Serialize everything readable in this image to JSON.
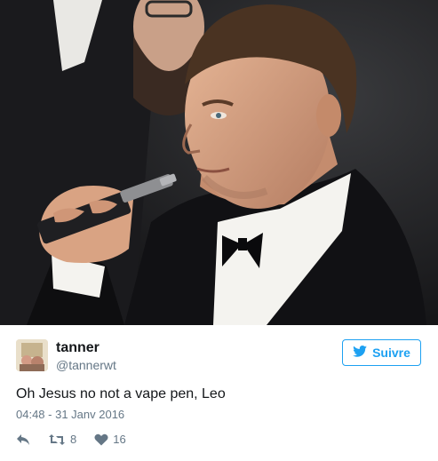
{
  "tweet": {
    "name": "tanner",
    "handle": "@tannerwt",
    "follow_label": "Suivre",
    "text": "Oh Jesus no not a vape pen, Leo",
    "timestamp": "04:48 - 31 Janv 2016",
    "retweet_count": "8",
    "like_count": "16"
  },
  "icons": {
    "follow": "twitter-bird-icon",
    "reply": "reply-arrow-icon",
    "retweet": "retweet-icon",
    "like": "heart-icon"
  },
  "colors": {
    "accent": "#1da1f2",
    "secondary_text": "#657786",
    "primary_text": "#14171a"
  }
}
